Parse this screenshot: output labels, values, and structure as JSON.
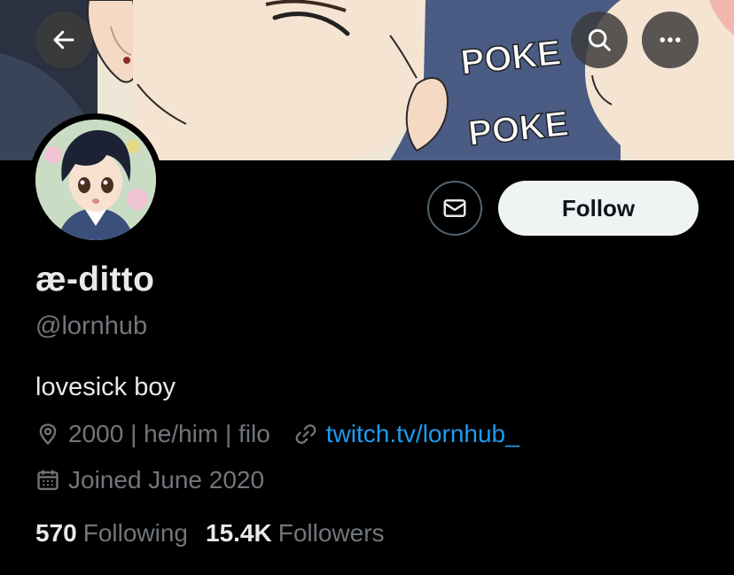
{
  "banner": {
    "sfx_1": "POKE",
    "sfx_2": "POKE"
  },
  "header": {
    "back_icon": "arrow-left-icon",
    "search_icon": "search-icon",
    "more_icon": "more-dots-icon"
  },
  "profile": {
    "display_name": "æ-ditto",
    "handle": "@lornhub",
    "bio": "lovesick boy",
    "location": "2000 | he/him | filo",
    "website": "twitch.tv/lornhub_",
    "joined": "Joined June 2020",
    "following_count": "570",
    "following_label": "Following",
    "followers_count": "15.4K",
    "followers_label": "Followers"
  },
  "actions": {
    "follow_label": "Follow",
    "message_icon": "envelope-icon"
  },
  "colors": {
    "background": "#000000",
    "primary_text": "#e7e9ea",
    "secondary_text": "#71767b",
    "link": "#1d9bf0",
    "follow_button_bg": "#eff3f4"
  }
}
